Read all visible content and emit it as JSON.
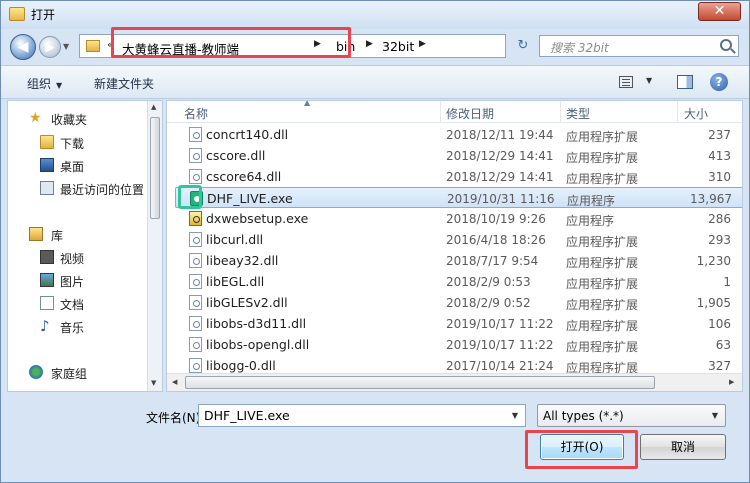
{
  "window": {
    "title": "打开",
    "close_glyph": "✕"
  },
  "nav": {
    "back_glyph": "◀",
    "forward_glyph": "▶",
    "history_glyph": "▼",
    "breadcrumbs": [
      "大黄蜂云直播-教师端",
      "bin",
      "32bit"
    ],
    "crumb_sep": "▶",
    "root_sep": "«",
    "search_placeholder": "搜索 32bit",
    "refresh_glyph": "↻"
  },
  "toolbar": {
    "organize_label": "组织",
    "new_folder_label": "新建文件夹",
    "help_glyph": "?",
    "dropdown_glyph": "▼"
  },
  "sidebar": {
    "items": [
      {
        "label": "收藏夹",
        "icon": "favorites-star-icon"
      },
      {
        "label": "下载",
        "icon": "downloads-folder-icon"
      },
      {
        "label": "桌面",
        "icon": "desktop-monitor-icon"
      },
      {
        "label": "最近访问的位置",
        "icon": "recent-places-icon"
      },
      {
        "label": "库",
        "icon": "library-icon"
      },
      {
        "label": "视频",
        "icon": "videos-icon"
      },
      {
        "label": "图片",
        "icon": "pictures-icon"
      },
      {
        "label": "文档",
        "icon": "documents-icon"
      },
      {
        "label": "音乐",
        "icon": "music-icon"
      },
      {
        "label": "家庭组",
        "icon": "homegroup-icon"
      }
    ],
    "star_glyph": "★",
    "music_glyph": "♪"
  },
  "columns": {
    "name": "名称",
    "date": "修改日期",
    "type": "类型",
    "size": "大小",
    "sort_glyph": "▲"
  },
  "files": [
    {
      "name": "concrt140.dll",
      "date": "2018/12/11 19:44",
      "type": "应用程序扩展",
      "size": "237",
      "kind": "dll"
    },
    {
      "name": "cscore.dll",
      "date": "2018/12/29 14:41",
      "type": "应用程序扩展",
      "size": "413",
      "kind": "dll"
    },
    {
      "name": "cscore64.dll",
      "date": "2018/12/29 14:41",
      "type": "应用程序扩展",
      "size": "310",
      "kind": "dll"
    },
    {
      "name": "DHF_LIVE.exe",
      "date": "2019/10/31 11:16",
      "type": "应用程序",
      "size": "13,967",
      "kind": "exe"
    },
    {
      "name": "dxwebsetup.exe",
      "date": "2018/10/19 9:26",
      "type": "应用程序",
      "size": "286",
      "kind": "setup"
    },
    {
      "name": "libcurl.dll",
      "date": "2016/4/18 18:26",
      "type": "应用程序扩展",
      "size": "293",
      "kind": "dll"
    },
    {
      "name": "libeay32.dll",
      "date": "2018/7/17 9:54",
      "type": "应用程序扩展",
      "size": "1,230",
      "kind": "dll"
    },
    {
      "name": "libEGL.dll",
      "date": "2018/2/9 0:53",
      "type": "应用程序扩展",
      "size": "1",
      "kind": "dll"
    },
    {
      "name": "libGLESv2.dll",
      "date": "2018/2/9 0:52",
      "type": "应用程序扩展",
      "size": "1,905",
      "kind": "dll"
    },
    {
      "name": "libobs-d3d11.dll",
      "date": "2019/10/17 11:22",
      "type": "应用程序扩展",
      "size": "106",
      "kind": "dll"
    },
    {
      "name": "libobs-opengl.dll",
      "date": "2019/10/17 11:22",
      "type": "应用程序扩展",
      "size": "63",
      "kind": "dll"
    },
    {
      "name": "libogg-0.dll",
      "date": "2017/10/14 21:24",
      "type": "应用程序扩展",
      "size": "327",
      "kind": "dll"
    }
  ],
  "bottom": {
    "filename_label": "文件名(N):",
    "filename_value": "DHF_LIVE.exe",
    "filter_value": "All types (*.*)",
    "open_label": "打开(O)",
    "cancel_label": "取消"
  },
  "colors": {
    "highlight_red": "#e8454f",
    "highlight_green": "#2ec79a",
    "selection": "#cfe2f7"
  }
}
